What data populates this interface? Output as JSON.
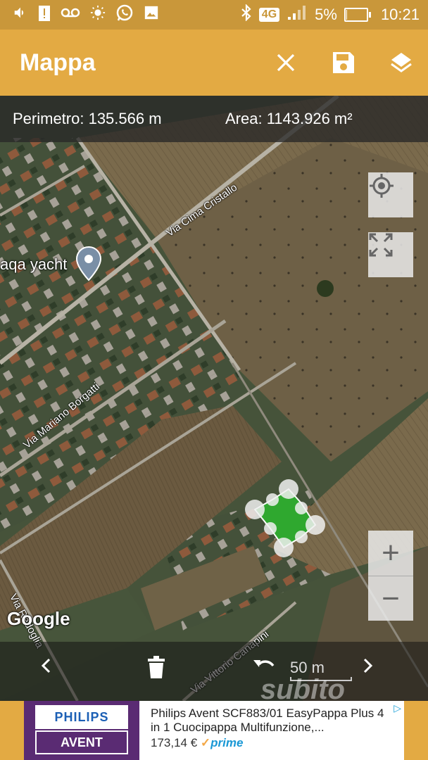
{
  "status_bar": {
    "network": "4G",
    "battery_percent": "5%",
    "battery_level": 0.05,
    "time": "10:21",
    "icons": [
      "volume-icon",
      "battery-alert-icon",
      "voicemail-icon",
      "brightness-icon",
      "whatsapp-icon",
      "image-icon",
      "bluetooth-icon",
      "signal-icon"
    ]
  },
  "app_bar": {
    "title": "Mappa",
    "actions": [
      "close-icon",
      "save-icon",
      "layers-icon"
    ]
  },
  "measure": {
    "perimeter": "Perimetro: 135.566 m",
    "area": "Area: 1143.926 m²"
  },
  "map": {
    "place_label": "aqa yacht",
    "streets": {
      "cima_cristallo": "Via Cima Cristallo",
      "mariano_borgatti": "Via Mariano Borgatti",
      "redoglia": "Via Redoglia",
      "vittorio_canapini": "Via Vittorio Canapini"
    },
    "attribution": "Google",
    "zoom_in": "+",
    "zoom_out": "−",
    "polygon_color": "#2fa82f"
  },
  "bottom_bar": {
    "scale": "50 m",
    "icons": [
      "chevron-left-icon",
      "delete-icon",
      "undo-icon",
      "chevron-right-icon"
    ]
  },
  "ad": {
    "brand_top": "PHILIPS",
    "brand_bottom": "AVENT",
    "title": "Philips Avent SCF883/01 EasyPappa Plus 4 in 1 Cuocipappa Multifunzione,...",
    "price": "173,14 €",
    "prime": "prime",
    "prime_check": "✓"
  },
  "watermark": "subito"
}
